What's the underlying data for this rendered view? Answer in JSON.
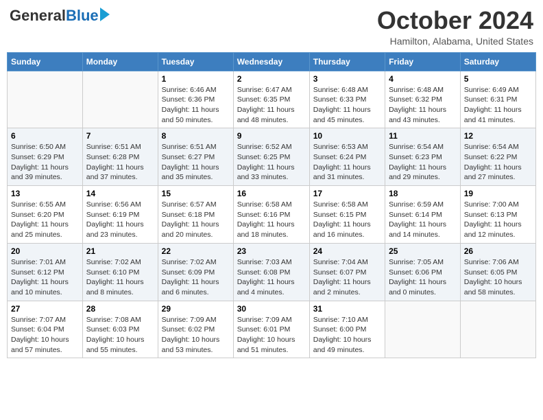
{
  "logo": {
    "general": "General",
    "blue": "Blue"
  },
  "header": {
    "month": "October 2024",
    "location": "Hamilton, Alabama, United States"
  },
  "days_of_week": [
    "Sunday",
    "Monday",
    "Tuesday",
    "Wednesday",
    "Thursday",
    "Friday",
    "Saturday"
  ],
  "weeks": [
    [
      {
        "day": "",
        "info": ""
      },
      {
        "day": "",
        "info": ""
      },
      {
        "day": "1",
        "info": "Sunrise: 6:46 AM\nSunset: 6:36 PM\nDaylight: 11 hours and 50 minutes."
      },
      {
        "day": "2",
        "info": "Sunrise: 6:47 AM\nSunset: 6:35 PM\nDaylight: 11 hours and 48 minutes."
      },
      {
        "day": "3",
        "info": "Sunrise: 6:48 AM\nSunset: 6:33 PM\nDaylight: 11 hours and 45 minutes."
      },
      {
        "day": "4",
        "info": "Sunrise: 6:48 AM\nSunset: 6:32 PM\nDaylight: 11 hours and 43 minutes."
      },
      {
        "day": "5",
        "info": "Sunrise: 6:49 AM\nSunset: 6:31 PM\nDaylight: 11 hours and 41 minutes."
      }
    ],
    [
      {
        "day": "6",
        "info": "Sunrise: 6:50 AM\nSunset: 6:29 PM\nDaylight: 11 hours and 39 minutes."
      },
      {
        "day": "7",
        "info": "Sunrise: 6:51 AM\nSunset: 6:28 PM\nDaylight: 11 hours and 37 minutes."
      },
      {
        "day": "8",
        "info": "Sunrise: 6:51 AM\nSunset: 6:27 PM\nDaylight: 11 hours and 35 minutes."
      },
      {
        "day": "9",
        "info": "Sunrise: 6:52 AM\nSunset: 6:25 PM\nDaylight: 11 hours and 33 minutes."
      },
      {
        "day": "10",
        "info": "Sunrise: 6:53 AM\nSunset: 6:24 PM\nDaylight: 11 hours and 31 minutes."
      },
      {
        "day": "11",
        "info": "Sunrise: 6:54 AM\nSunset: 6:23 PM\nDaylight: 11 hours and 29 minutes."
      },
      {
        "day": "12",
        "info": "Sunrise: 6:54 AM\nSunset: 6:22 PM\nDaylight: 11 hours and 27 minutes."
      }
    ],
    [
      {
        "day": "13",
        "info": "Sunrise: 6:55 AM\nSunset: 6:20 PM\nDaylight: 11 hours and 25 minutes."
      },
      {
        "day": "14",
        "info": "Sunrise: 6:56 AM\nSunset: 6:19 PM\nDaylight: 11 hours and 23 minutes."
      },
      {
        "day": "15",
        "info": "Sunrise: 6:57 AM\nSunset: 6:18 PM\nDaylight: 11 hours and 20 minutes."
      },
      {
        "day": "16",
        "info": "Sunrise: 6:58 AM\nSunset: 6:16 PM\nDaylight: 11 hours and 18 minutes."
      },
      {
        "day": "17",
        "info": "Sunrise: 6:58 AM\nSunset: 6:15 PM\nDaylight: 11 hours and 16 minutes."
      },
      {
        "day": "18",
        "info": "Sunrise: 6:59 AM\nSunset: 6:14 PM\nDaylight: 11 hours and 14 minutes."
      },
      {
        "day": "19",
        "info": "Sunrise: 7:00 AM\nSunset: 6:13 PM\nDaylight: 11 hours and 12 minutes."
      }
    ],
    [
      {
        "day": "20",
        "info": "Sunrise: 7:01 AM\nSunset: 6:12 PM\nDaylight: 11 hours and 10 minutes."
      },
      {
        "day": "21",
        "info": "Sunrise: 7:02 AM\nSunset: 6:10 PM\nDaylight: 11 hours and 8 minutes."
      },
      {
        "day": "22",
        "info": "Sunrise: 7:02 AM\nSunset: 6:09 PM\nDaylight: 11 hours and 6 minutes."
      },
      {
        "day": "23",
        "info": "Sunrise: 7:03 AM\nSunset: 6:08 PM\nDaylight: 11 hours and 4 minutes."
      },
      {
        "day": "24",
        "info": "Sunrise: 7:04 AM\nSunset: 6:07 PM\nDaylight: 11 hours and 2 minutes."
      },
      {
        "day": "25",
        "info": "Sunrise: 7:05 AM\nSunset: 6:06 PM\nDaylight: 11 hours and 0 minutes."
      },
      {
        "day": "26",
        "info": "Sunrise: 7:06 AM\nSunset: 6:05 PM\nDaylight: 10 hours and 58 minutes."
      }
    ],
    [
      {
        "day": "27",
        "info": "Sunrise: 7:07 AM\nSunset: 6:04 PM\nDaylight: 10 hours and 57 minutes."
      },
      {
        "day": "28",
        "info": "Sunrise: 7:08 AM\nSunset: 6:03 PM\nDaylight: 10 hours and 55 minutes."
      },
      {
        "day": "29",
        "info": "Sunrise: 7:09 AM\nSunset: 6:02 PM\nDaylight: 10 hours and 53 minutes."
      },
      {
        "day": "30",
        "info": "Sunrise: 7:09 AM\nSunset: 6:01 PM\nDaylight: 10 hours and 51 minutes."
      },
      {
        "day": "31",
        "info": "Sunrise: 7:10 AM\nSunset: 6:00 PM\nDaylight: 10 hours and 49 minutes."
      },
      {
        "day": "",
        "info": ""
      },
      {
        "day": "",
        "info": ""
      }
    ]
  ]
}
